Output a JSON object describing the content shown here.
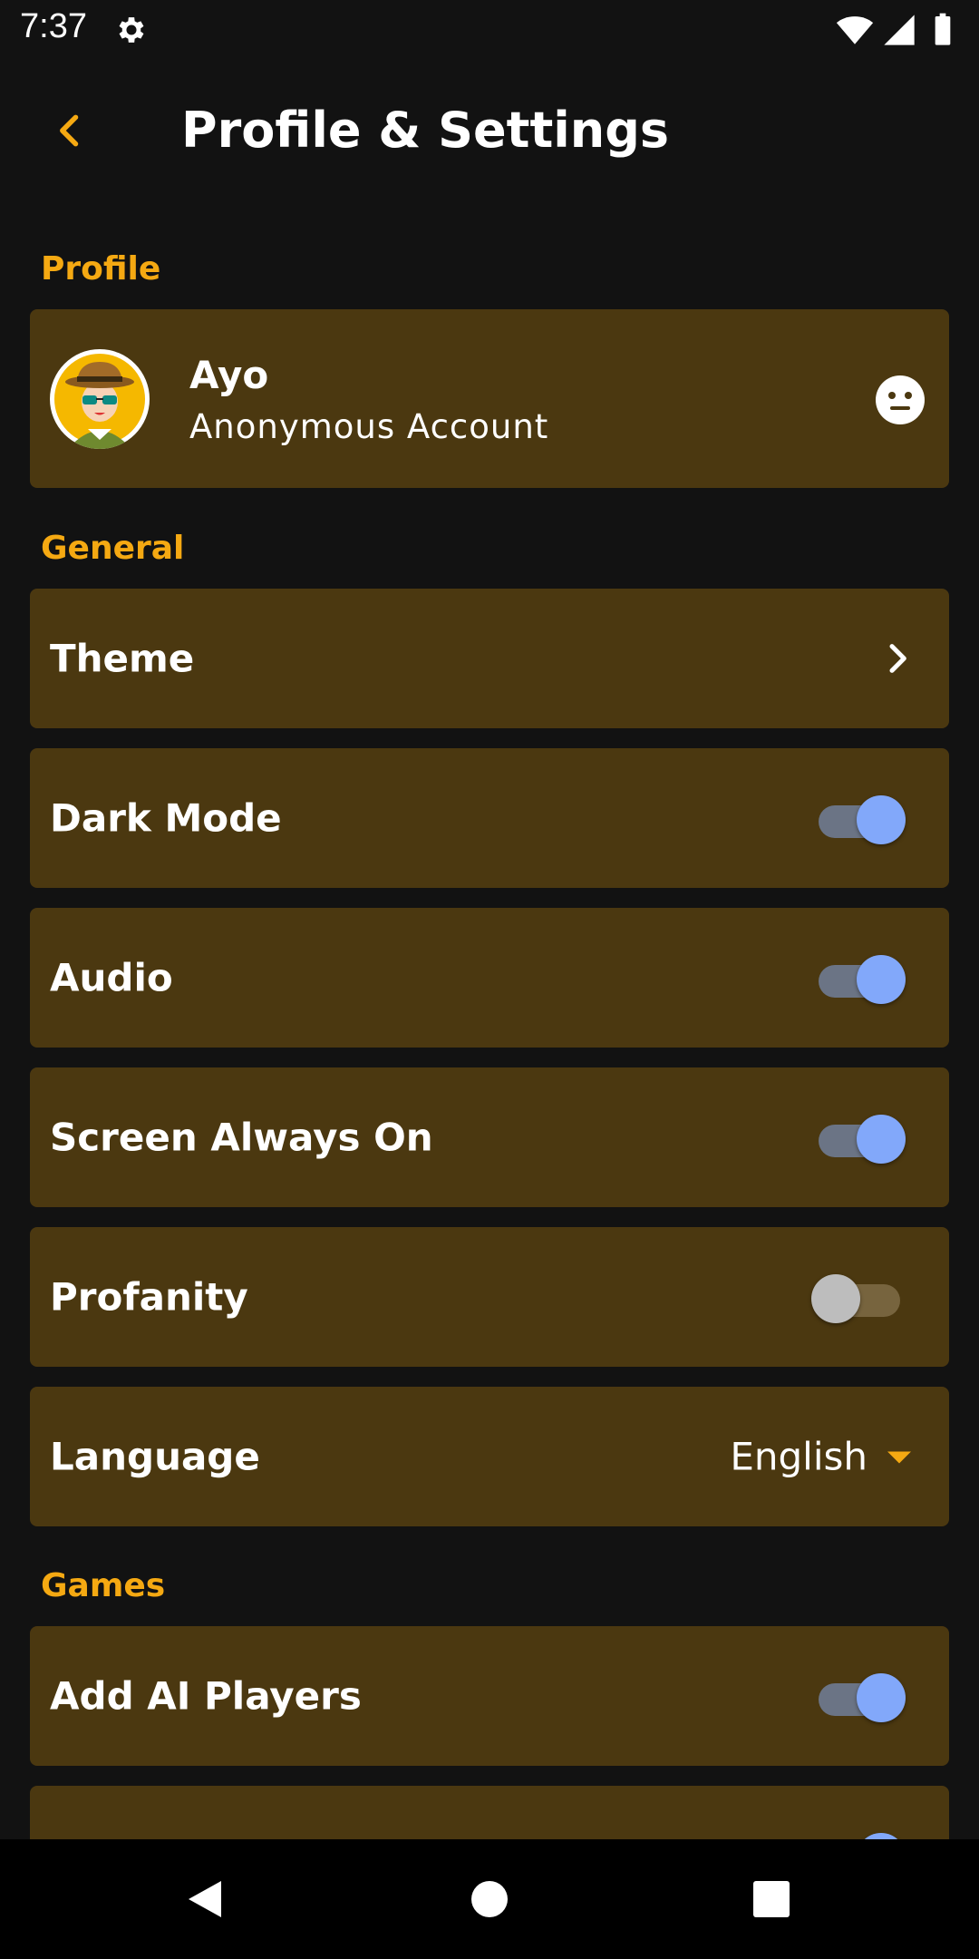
{
  "status_bar": {
    "time": "7:37",
    "icons": [
      "settings-icon",
      "wifi-icon",
      "signal-icon",
      "battery-icon"
    ]
  },
  "header": {
    "title": "Profile & Settings",
    "back_icon": "chevron-left-icon"
  },
  "sections": {
    "profile": "Profile",
    "general": "General",
    "games": "Games"
  },
  "profile": {
    "name": "Ayo",
    "subtitle": "Anonymous Account",
    "avatar_icon": "detective-avatar",
    "status_icon": "neutral-face-icon"
  },
  "general": {
    "theme_label": "Theme",
    "dark_mode_label": "Dark Mode",
    "dark_mode_on": true,
    "audio_label": "Audio",
    "audio_on": true,
    "screen_on_label": "Screen Always On",
    "screen_on_on": true,
    "profanity_label": "Profanity",
    "profanity_on": false,
    "language_label": "Language",
    "language_value": "English"
  },
  "games": {
    "ai_players_label": "Add AI Players",
    "ai_players_on": true
  },
  "colors": {
    "background": "#121212",
    "card": "#4b3810",
    "accent": "#f5a912",
    "toggle_on_thumb": "#82a8fa",
    "toggle_on_track": "#6b7485",
    "toggle_off_thumb": "#bdbdbd"
  }
}
